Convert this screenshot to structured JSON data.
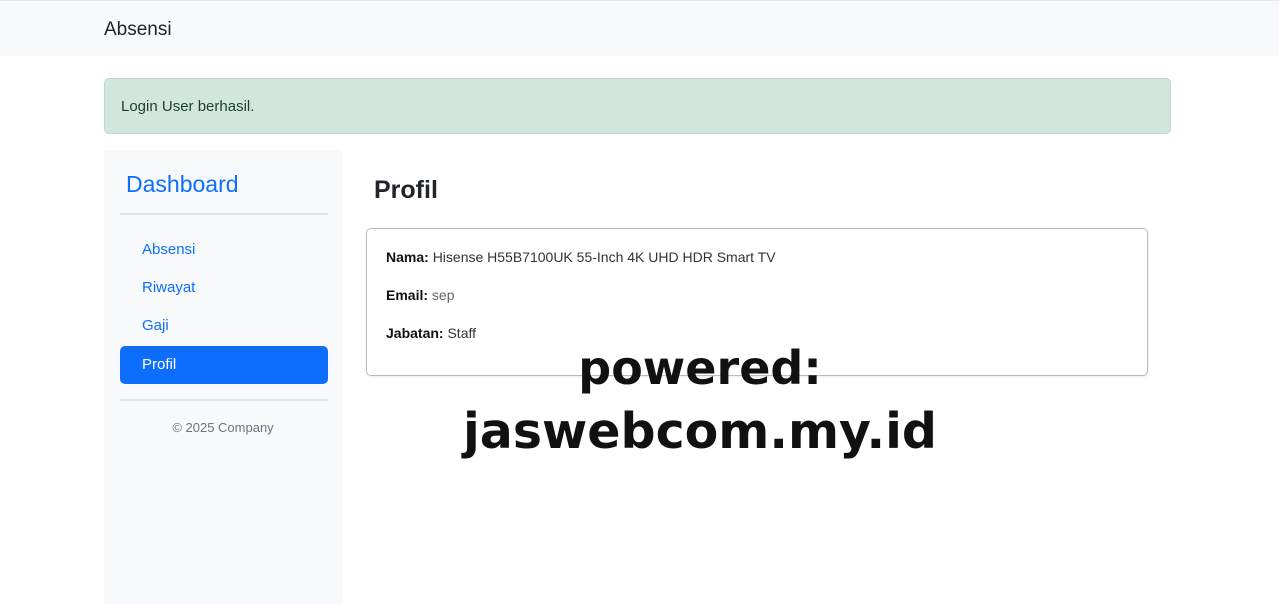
{
  "navbar": {
    "brand": "Absensi"
  },
  "alert": {
    "message": "Login User berhasil."
  },
  "sidebar": {
    "title": "Dashboard",
    "items": [
      {
        "label": "Absensi",
        "active": false
      },
      {
        "label": "Riwayat",
        "active": false
      },
      {
        "label": "Gaji",
        "active": false
      },
      {
        "label": "Profil",
        "active": true
      }
    ],
    "copyright": "© 2025 Company"
  },
  "main": {
    "title": "Profil",
    "profile": {
      "name_label": "Nama:",
      "name_value": "Hisense H55B7100UK 55-Inch 4K UHD HDR Smart TV",
      "email_label": "Email:",
      "email_value": "sep",
      "role_label": "Jabatan:",
      "role_value": "Staff"
    }
  },
  "watermark": {
    "line1": "powered:",
    "line2": "jaswebcom.my.id"
  },
  "colors": {
    "primary": "#0d6efd",
    "alert_bg": "#d1e7dd",
    "navbar_bg": "#f8f9fa",
    "sidebar_bg": "#f8f9fa"
  }
}
